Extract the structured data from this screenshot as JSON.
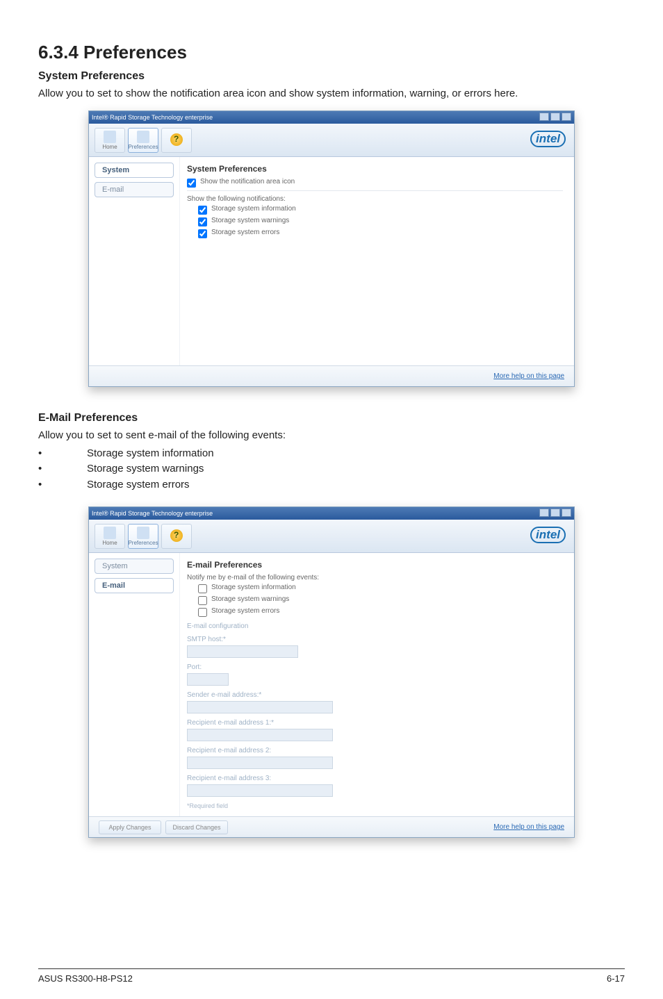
{
  "heading": "6.3.4    Preferences",
  "section1": {
    "title": "System Preferences",
    "desc": "Allow you to set to show the notification area icon and show system information, warning, or errors here.",
    "window": {
      "title": "Intel® Rapid Storage Technology enterprise",
      "brand": "intel",
      "toolbar": {
        "home": "Home",
        "pref": "Preferences"
      },
      "tabs": {
        "system": "System",
        "email": "E-mail"
      },
      "content_title": "System Preferences",
      "chk_icon": "Show the notification area icon",
      "chk_group_label": "Show the following notifications:",
      "chk1": "Storage system information",
      "chk2": "Storage system warnings",
      "chk3": "Storage system errors",
      "footer_link": "More help on this page"
    }
  },
  "section2": {
    "title": "E-Mail Preferences",
    "desc": "Allow you to set to sent e-mail of the following events:",
    "bullets": [
      "Storage system information",
      "Storage system warnings",
      "Storage system errors"
    ],
    "window": {
      "title": "Intel® Rapid Storage Technology enterprise",
      "brand": "intel",
      "toolbar": {
        "home": "Home",
        "pref": "Preferences"
      },
      "tabs": {
        "system": "System",
        "email": "E-mail"
      },
      "content_title": "E-mail Preferences",
      "chk_notify": "Notify me by e-mail of the following events:",
      "chk1": "Storage system information",
      "chk2": "Storage system warnings",
      "chk3": "Storage system errors",
      "config_label": "E-mail configuration",
      "fields": {
        "smtp": "SMTP host:*",
        "port": "Port:",
        "sender": "Sender e-mail address:*",
        "r1": "Recipient e-mail address 1:*",
        "r2": "Recipient e-mail address 2:",
        "r3": "Recipient e-mail address 3:"
      },
      "required": "*Required field",
      "buttons": {
        "apply": "Apply Changes",
        "discard": "Discard Changes"
      },
      "footer_link": "More help on this page"
    }
  },
  "footer": {
    "left": "ASUS RS300-H8-PS12",
    "right": "6-17"
  }
}
